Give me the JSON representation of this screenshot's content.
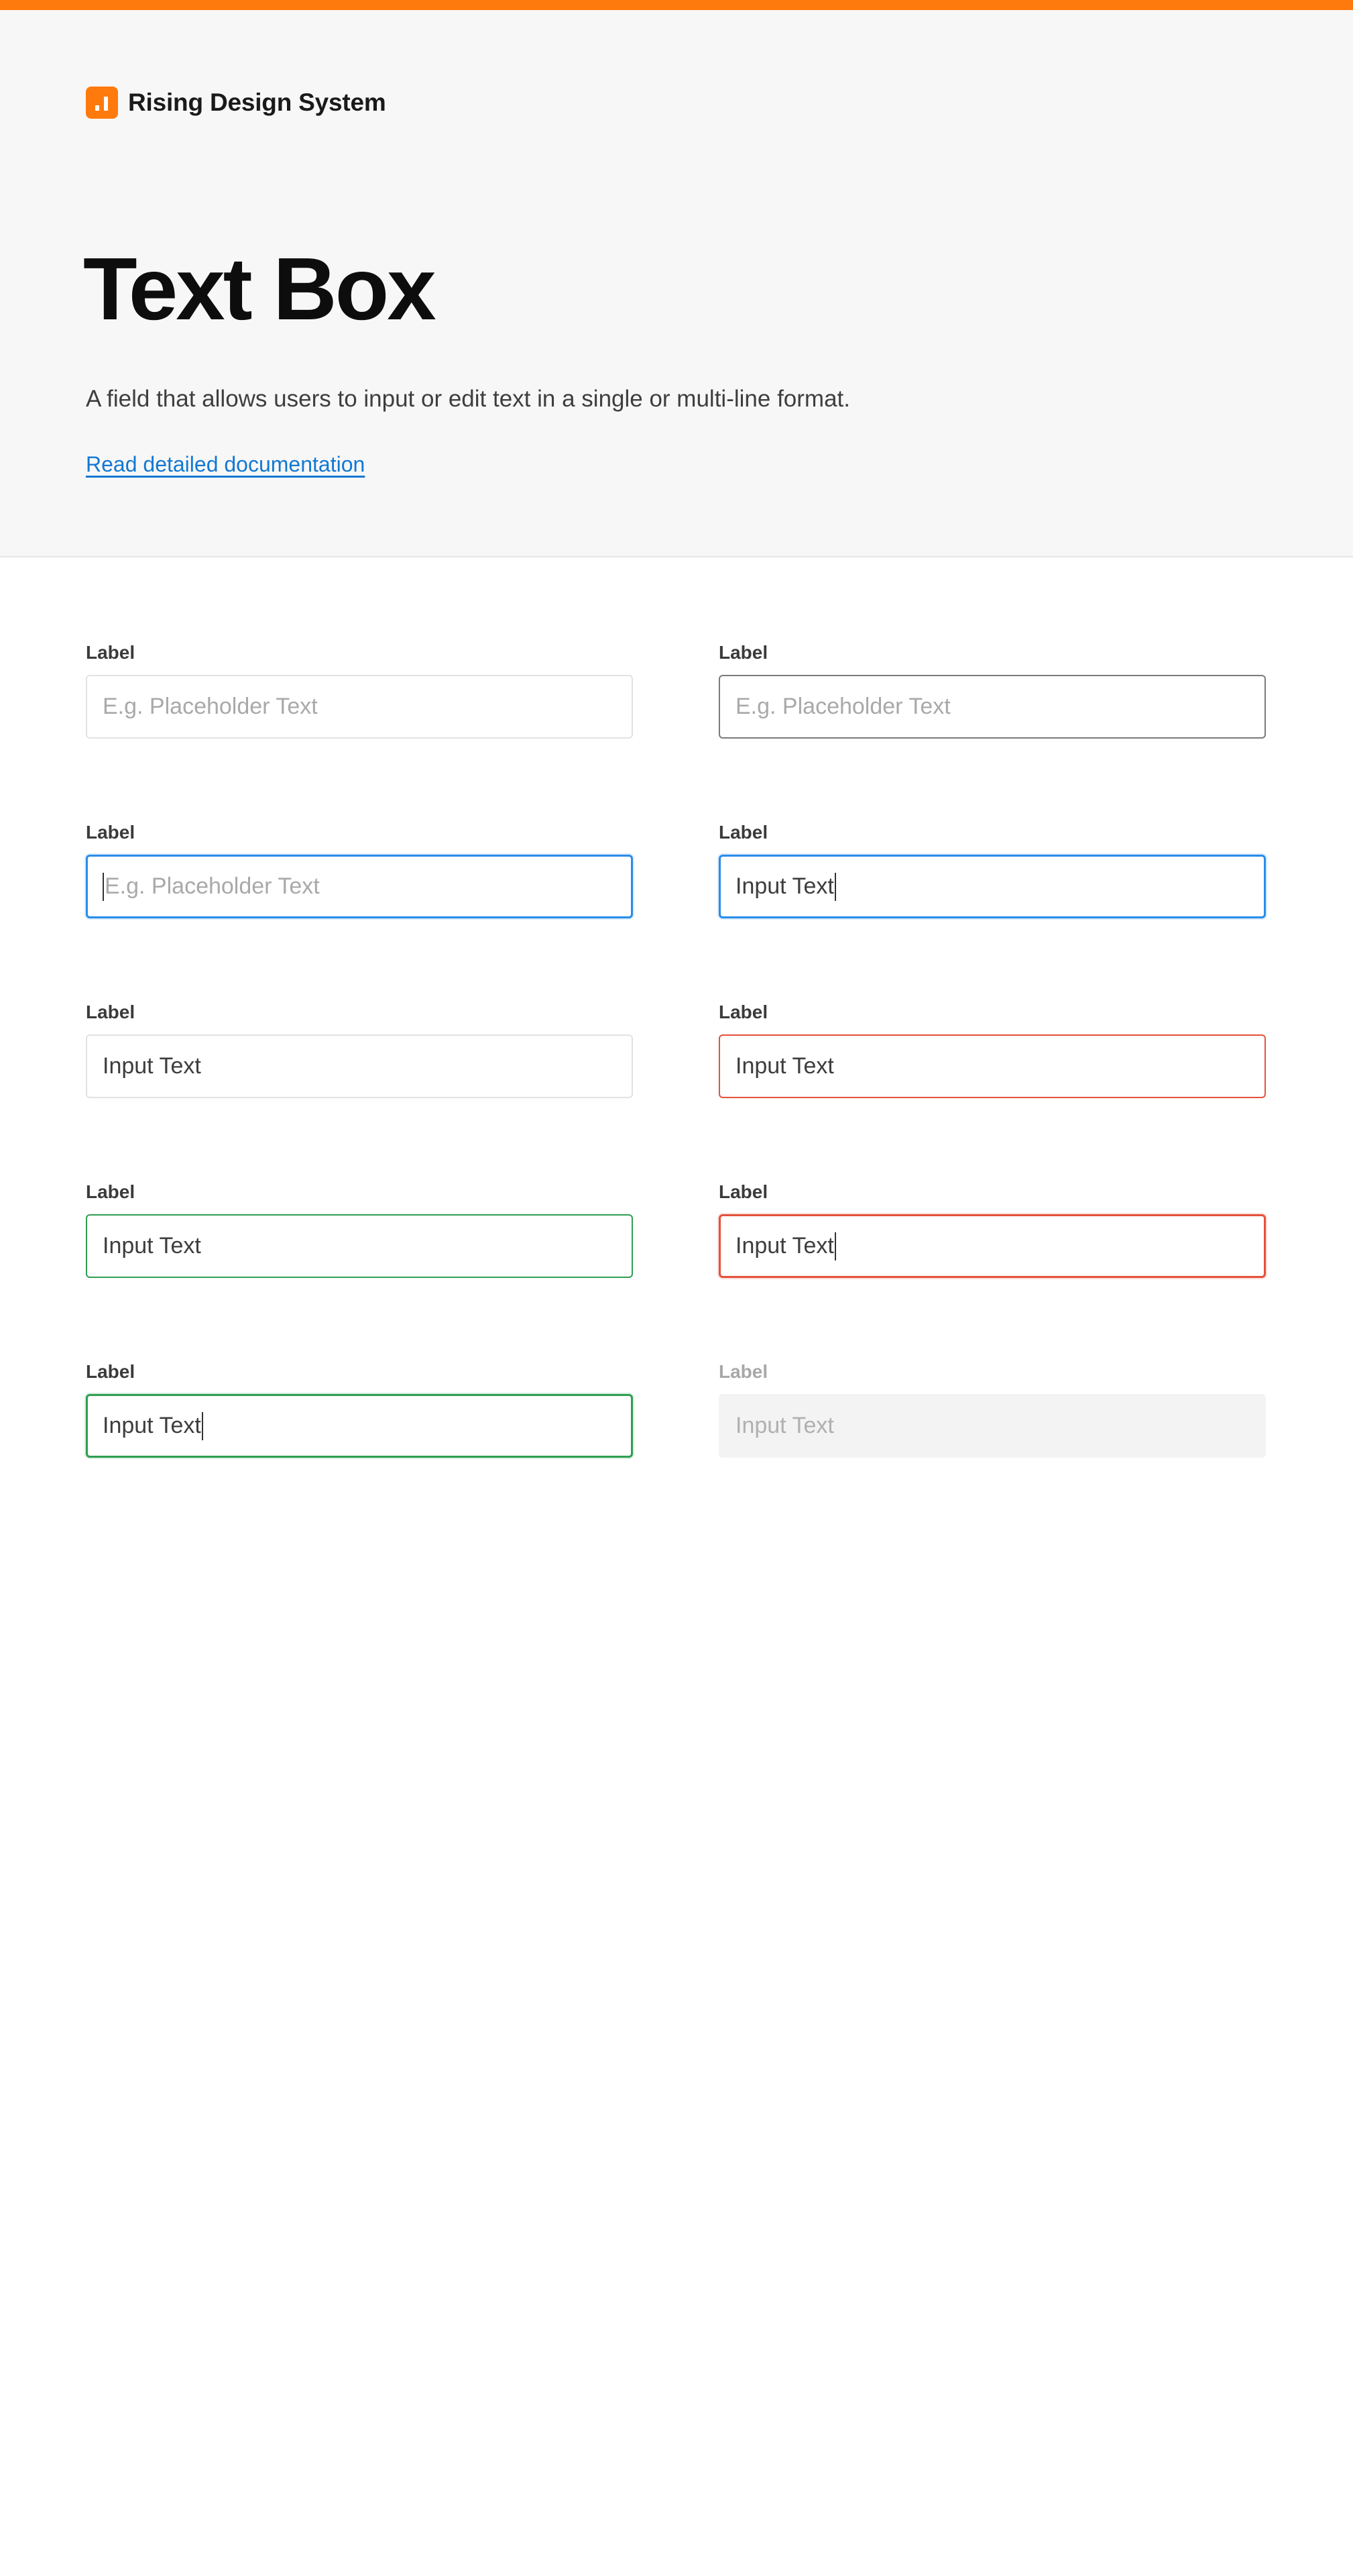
{
  "header": {
    "brand_name": "Rising Design System",
    "title": "Text Box",
    "description": "A field that allows users to input or edit text in a single or multi-line format.",
    "doc_link": "Read detailed documentation"
  },
  "colors": {
    "accent": "#ff7a0c",
    "link": "#1278d3",
    "focus": "#2a8de8",
    "error": "#e5513b",
    "success": "#2f9e52",
    "disabled_bg": "#f3f3f3"
  },
  "fields": [
    {
      "label": "Label",
      "placeholder": "E.g. Placeholder Text",
      "value": "",
      "state": "default"
    },
    {
      "label": "Label",
      "placeholder": "E.g. Placeholder Text",
      "value": "",
      "state": "hover"
    },
    {
      "label": "Label",
      "placeholder": "E.g. Placeholder Text",
      "value": "",
      "state": "focus"
    },
    {
      "label": "Label",
      "placeholder": "",
      "value": "Input Text",
      "state": "focus-typing"
    },
    {
      "label": "Label",
      "placeholder": "",
      "value": "Input Text",
      "state": "filled"
    },
    {
      "label": "Label",
      "placeholder": "",
      "value": "Input Text",
      "state": "error"
    },
    {
      "label": "Label",
      "placeholder": "",
      "value": "Input Text",
      "state": "success"
    },
    {
      "label": "Label",
      "placeholder": "",
      "value": "Input Text",
      "state": "error-focus"
    },
    {
      "label": "Label",
      "placeholder": "",
      "value": "Input Text",
      "state": "success-focus"
    },
    {
      "label": "Label",
      "placeholder": "",
      "value": "Input Text",
      "state": "disabled"
    }
  ]
}
